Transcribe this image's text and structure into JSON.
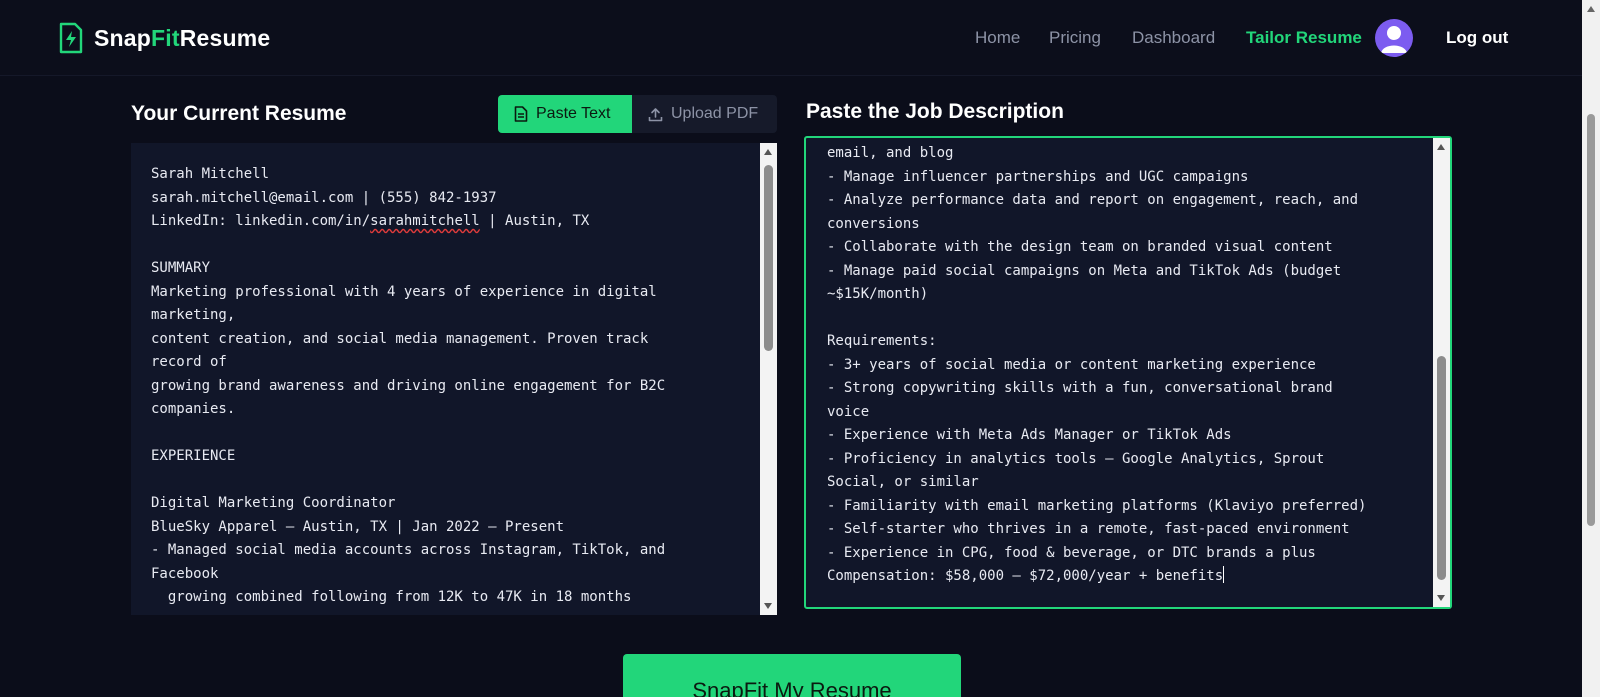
{
  "header": {
    "logo": {
      "part1": "Snap",
      "part2": "Fit",
      "part3": "Resume"
    },
    "nav": [
      {
        "label": "Home"
      },
      {
        "label": "Pricing"
      },
      {
        "label": "Dashboard"
      },
      {
        "label": "Tailor Resume"
      }
    ],
    "logout_label": "Log out"
  },
  "resume": {
    "heading": "Your Current Resume",
    "toggle": {
      "paste_label": "Paste Text",
      "upload_label": "Upload PDF"
    },
    "line1": "Sarah Mitchell",
    "line2": "sarah.mitchell@email.com | (555) 842-1937",
    "line3_prefix": "LinkedIn: linkedin.com/in/",
    "line3_link": "sarahmitchell",
    "line3_suffix": " | Austin, TX",
    "body": "\nSUMMARY\nMarketing professional with 4 years of experience in digital\nmarketing,\ncontent creation, and social media management. Proven track\nrecord of\ngrowing brand awareness and driving online engagement for B2C\ncompanies.\n\nEXPERIENCE\n\nDigital Marketing Coordinator\nBlueSky Apparel — Austin, TX | Jan 2022 – Present\n- Managed social media accounts across Instagram, TikTok, and\nFacebook\n  growing combined following from 12K to 47K in 18 months"
  },
  "job": {
    "heading": "Paste the Job Description",
    "body": "email, and blog\n- Manage influencer partnerships and UGC campaigns\n- Analyze performance data and report on engagement, reach, and\nconversions\n- Collaborate with the design team on branded visual content\n- Manage paid social campaigns on Meta and TikTok Ads (budget\n~$15K/month)\n\nRequirements:\n- 3+ years of social media or content marketing experience\n- Strong copywriting skills with a fun, conversational brand\nvoice\n- Experience with Meta Ads Manager or TikTok Ads\n- Proficiency in analytics tools — Google Analytics, Sprout\nSocial, or similar\n- Familiarity with email marketing platforms (Klaviyo preferred)\n- Self-starter who thrives in a remote, fast-paced environment\n- Experience in CPG, food & beverage, or DTC brands a plus\n",
    "last_line": "Compensation: $58,000 – $72,000/year + benefits"
  },
  "submit_label": "SnapFit My Resume",
  "colors": {
    "accent": "#22d67a",
    "background": "#0b0d1a",
    "panel": "#111629",
    "avatar": "#7c5cf0"
  },
  "scroll": {
    "resume_position": 0.0,
    "job_position": 1.0
  }
}
